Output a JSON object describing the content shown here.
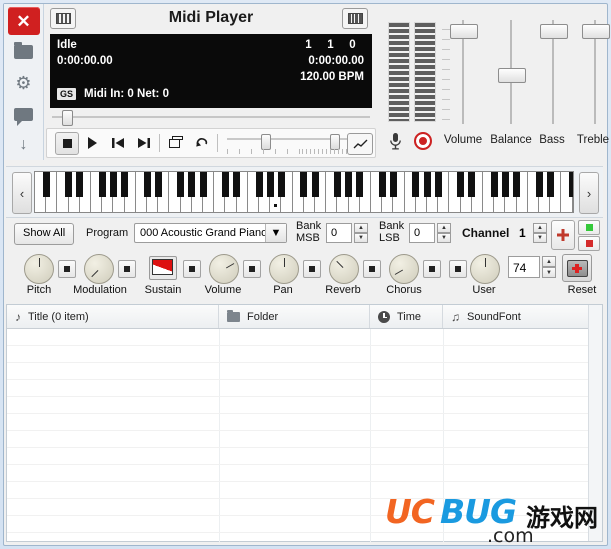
{
  "window": {
    "title": "Midi Player",
    "titlebar_icons": [
      {
        "name": "keyboard-grid-icon"
      },
      {
        "name": "analyzer-icon"
      }
    ]
  },
  "sidebar": {
    "items": [
      {
        "name": "close",
        "icon": "close-icon",
        "glyph": "✕"
      },
      {
        "name": "folder",
        "icon": "folder-icon"
      },
      {
        "name": "settings",
        "icon": "gear-icon",
        "glyph": "⚙"
      },
      {
        "name": "message",
        "icon": "speech-bubble-icon"
      },
      {
        "name": "download",
        "icon": "download-arrow-icon",
        "glyph": "↓"
      }
    ]
  },
  "display": {
    "status": "Idle",
    "elapsed": "0:00:00.00",
    "measure": "1",
    "beat": "1",
    "tick": "0",
    "total": "0:00:00.00",
    "tempo": "120.00 BPM",
    "mode_badge": "GS",
    "midi_in": "Midi In: 0  Net: 0"
  },
  "transport": {
    "buttons": [
      {
        "label": "Stop",
        "name": "stop-button",
        "icon": "stop-icon"
      },
      {
        "label": "Play",
        "name": "play-button",
        "icon": "play-icon"
      },
      {
        "label": "Previous",
        "name": "previous-button",
        "icon": "skip-back-icon"
      },
      {
        "label": "Next",
        "name": "next-button",
        "icon": "skip-forward-icon"
      },
      {
        "label": "Loop",
        "name": "loop-button",
        "icon": "window-icon"
      },
      {
        "label": "Undo",
        "name": "undo-button",
        "icon": "undo-arrow-icon"
      }
    ],
    "graph_button": "graph-button"
  },
  "mixer": {
    "sliders": [
      {
        "label": "Volume",
        "name": "volume-slider"
      },
      {
        "label": "Balance",
        "name": "balance-slider"
      },
      {
        "label": "Bass",
        "name": "bass-slider"
      },
      {
        "label": "Treble",
        "name": "treble-slider"
      }
    ],
    "mic_label": "microphone-icon",
    "record_label": "record-icon"
  },
  "program_row": {
    "show_all": "Show All",
    "program_label": "Program",
    "program_value": "000 Acoustic Grand Piano",
    "bank_msb_label_1": "Bank",
    "bank_msb_label_2": "MSB",
    "bank_msb_value": "0",
    "bank_lsb_label_1": "Bank",
    "bank_lsb_label_2": "LSB",
    "bank_lsb_value": "0",
    "channel_label": "Channel",
    "channel_value": "1",
    "add_button": "add-channel-button",
    "led_green": "#35c93a",
    "led_red": "#d42a2a"
  },
  "knobs": {
    "items": [
      {
        "label": "Pitch",
        "angle": 0
      },
      {
        "label": "Modulation",
        "angle": -135
      },
      {
        "label": "Sustain",
        "type": "pedal"
      },
      {
        "label": "Volume",
        "angle": 60
      },
      {
        "label": "Pan",
        "angle": 0
      },
      {
        "label": "Reverb",
        "angle": -45
      },
      {
        "label": "Chorus",
        "angle": -120
      },
      {
        "label": "User",
        "angle": 0
      }
    ],
    "user_value": "74",
    "reset_label": "Reset"
  },
  "playlist": {
    "columns": [
      {
        "label": "Title (0 item)",
        "icon": "music-note-icon"
      },
      {
        "label": "Folder",
        "icon": "folder-icon"
      },
      {
        "label": "Time",
        "icon": "clock-icon"
      },
      {
        "label": "SoundFont",
        "icon": "music-note-icon"
      }
    ],
    "rows": []
  },
  "watermark": {
    "uc": "UC",
    "bug": "BUG",
    "cn": "游戏网",
    "com": ".com"
  }
}
